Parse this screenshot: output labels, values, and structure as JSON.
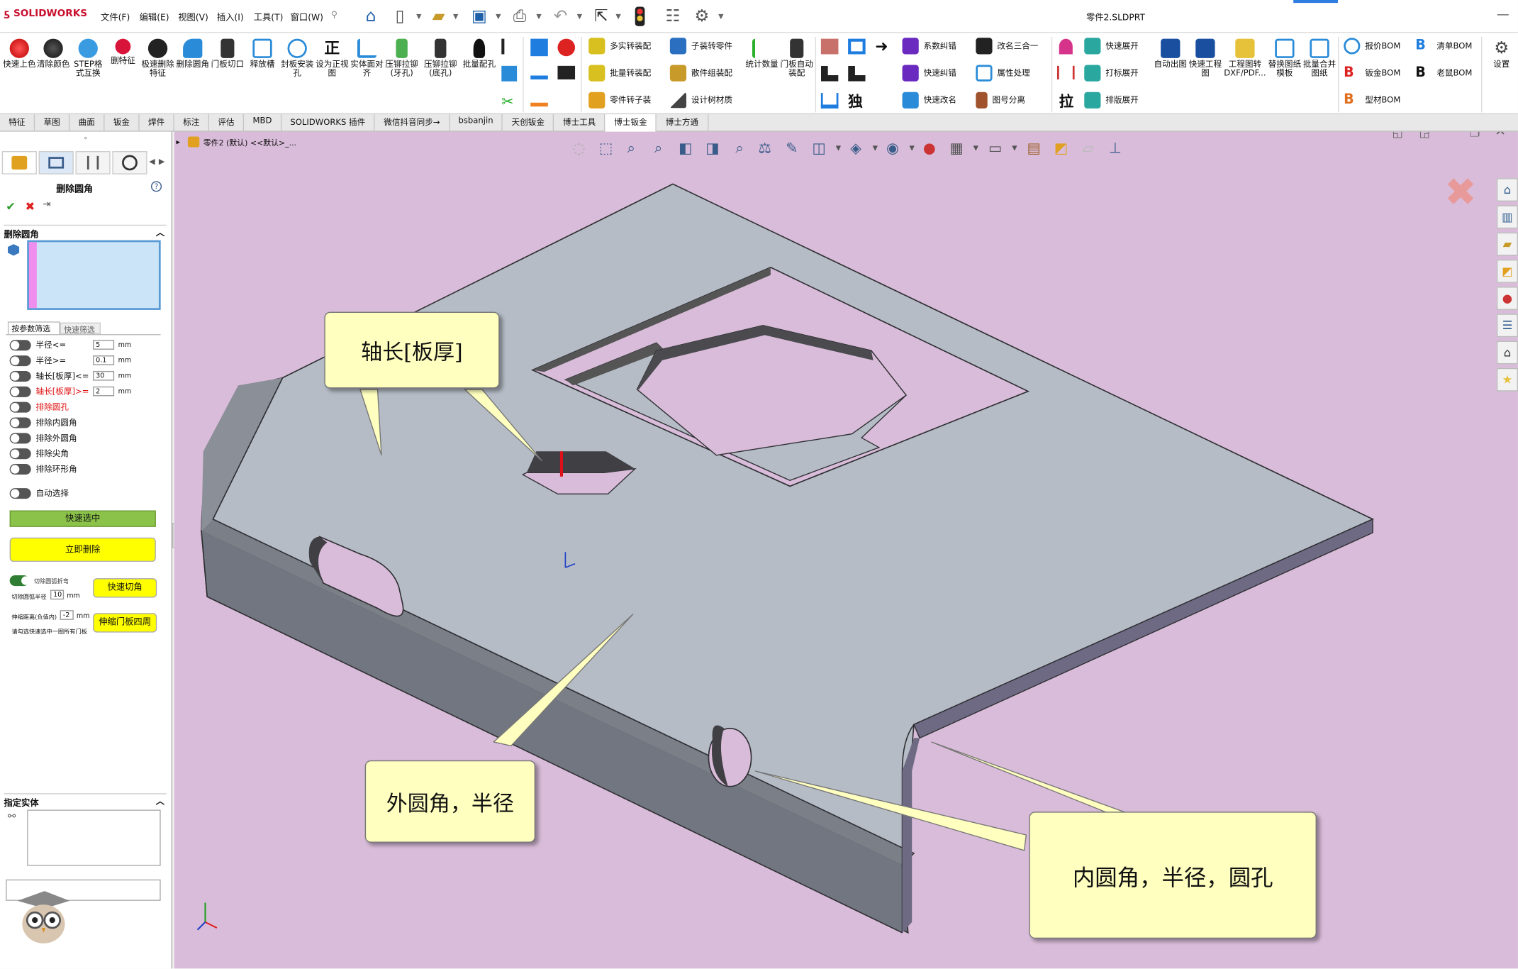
{
  "app": {
    "logo_text": "SOLIDWORKS",
    "doc_title": "零件2.SLDPRT"
  },
  "menus": [
    "文件(F)",
    "编辑(E)",
    "视图(V)",
    "插入(I)",
    "工具(T)",
    "窗口(W)"
  ],
  "ribbon_big": [
    {
      "label": "快速上色"
    },
    {
      "label": "清除颜色"
    },
    {
      "label": "STEP格式互换"
    },
    {
      "label": "删特征"
    },
    {
      "label": "极速删除特征"
    },
    {
      "label": "删除圆角"
    },
    {
      "label": "门板切口"
    },
    {
      "label": "释放槽"
    },
    {
      "label": "封板安装孔"
    },
    {
      "label": "设为正视图"
    },
    {
      "label": "实体面对齐"
    },
    {
      "label": "压铆拉铆(牙孔)"
    },
    {
      "label": "压铆拉铆(底孔)"
    },
    {
      "label": "批量配孔"
    }
  ],
  "ribbon_small": {
    "g1": [
      "多实转装配",
      "批量转装配",
      "零件转子装"
    ],
    "g2": [
      "子装转零件",
      "散件组装配",
      "设计树材质"
    ],
    "g3_big": [
      "统计数量",
      "门板自动装配"
    ],
    "g4": [
      "系数纠错",
      "快速纠错",
      "快速改名"
    ],
    "g5": [
      "改名三合一",
      "属性处理",
      "图号分离"
    ],
    "g6": [
      "快速展开",
      "打标展开",
      "排版展开"
    ],
    "g6_big": [
      "自动出图",
      "快速工程图",
      "工程图转DXF/PDF...",
      "替换图纸模板",
      "批量合并图纸"
    ],
    "g7": [
      "报价BOM",
      "钣金BOM",
      "型材BOM"
    ],
    "g8": [
      "清单BOM",
      "老鼠BOM"
    ],
    "settings": "设置",
    "glyph_du": "独",
    "glyph_la": "拉"
  },
  "tabs": [
    "特征",
    "草图",
    "曲面",
    "钣金",
    "焊件",
    "标注",
    "评估",
    "MBD",
    "SOLIDWORKS 插件",
    "微信抖音同步→",
    "bsbanjin",
    "天创钣金",
    "博士工具",
    "博士钣金",
    "博士方通"
  ],
  "active_tab": "博士钣金",
  "panel": {
    "title": "删除圆角",
    "section1": "删除圆角",
    "subtab1": "按参数筛选",
    "subtab2": "快速筛选",
    "options": [
      {
        "label": "半径<=",
        "value": "5",
        "unit": "mm",
        "red": false
      },
      {
        "label": "半径>=",
        "value": "0.1",
        "unit": "mm",
        "red": false
      },
      {
        "label": "轴长[板厚]<=",
        "value": "30",
        "unit": "mm",
        "red": false
      },
      {
        "label": "轴长[板厚]>=",
        "value": "2",
        "unit": "mm",
        "red": true
      },
      {
        "label": "排除圆孔",
        "red": true
      },
      {
        "label": "排除内圆角",
        "red": false
      },
      {
        "label": "排除外圆角",
        "red": false
      },
      {
        "label": "排除尖角",
        "red": false
      },
      {
        "label": "排除环形角",
        "red": false
      }
    ],
    "auto_select": "自动选择",
    "btn_quick_select": "快速选中",
    "btn_delete_now": "立即删除",
    "cut_label": "切除圆弧折弯",
    "cut_radius_label": "切除圆弧半径",
    "cut_radius_value": "10",
    "cut_radius_unit": "mm",
    "btn_quick_cut": "快速切角",
    "stretch_label": "伸缩距离(负值内)",
    "stretch_value": "-2",
    "stretch_unit": "mm",
    "stretch_note": "请勾选快速选中一圈所有门板",
    "btn_stretch": "伸缩门板四周",
    "section2": "指定实体"
  },
  "viewport": {
    "breadcrumb": "零件2 (默认) <<默认>_...",
    "callouts": [
      {
        "text": "轴长[板厚]"
      },
      {
        "text": "外圆角，半径"
      },
      {
        "text": "内圆角，半径，圆孔"
      }
    ]
  },
  "colors": {
    "viewport_bg": "#d9bcd9",
    "part_top": "#b5bcc6",
    "part_side": "#6c7077",
    "callout_bg": "#ffffc0",
    "green_btn": "#8bc34a",
    "yellow_btn": "#ffff00"
  }
}
